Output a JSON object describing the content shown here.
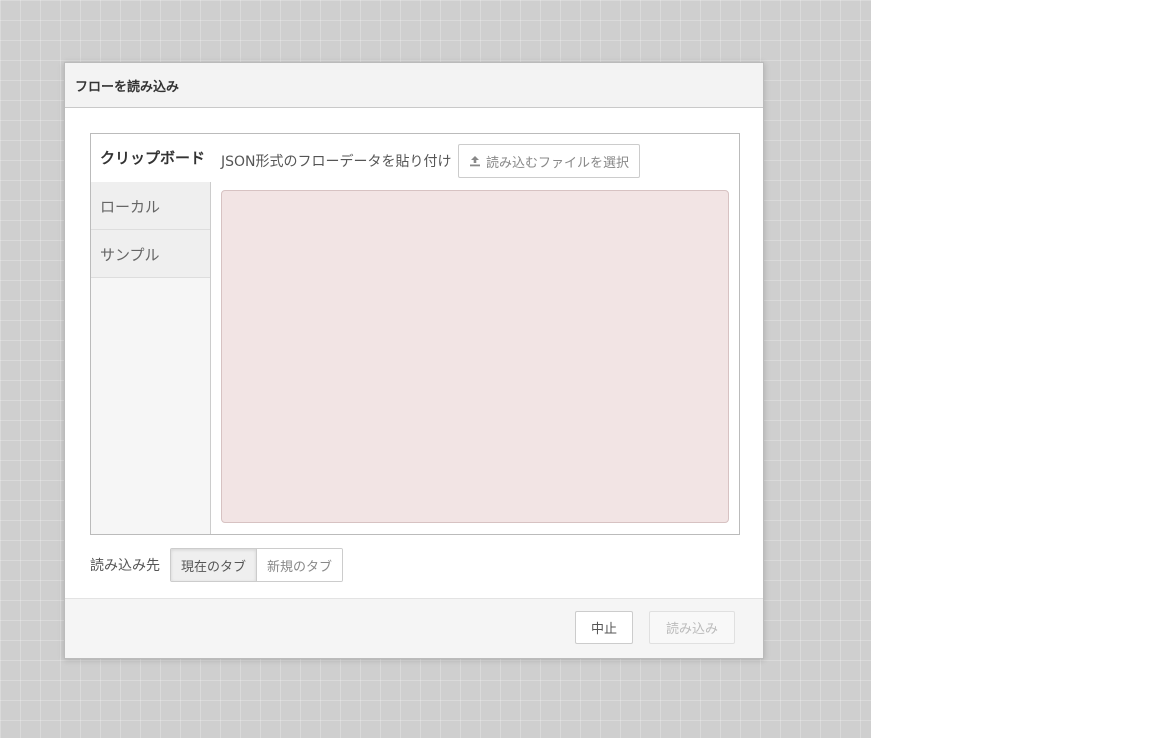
{
  "dialog": {
    "title": "フローを読み込み",
    "tabs": [
      {
        "label": "クリップボード",
        "active": true
      },
      {
        "label": "ローカル",
        "active": false
      },
      {
        "label": "サンプル",
        "active": false
      }
    ],
    "clipboard": {
      "paste_label": "JSON形式のフローデータを貼り付け",
      "select_file_label": "読み込むファイルを選択",
      "select_file_icon": "upload-icon",
      "textarea_value": ""
    },
    "target": {
      "label": "読み込み先",
      "options": [
        {
          "label": "現在のタブ",
          "selected": true
        },
        {
          "label": "新規のタブ",
          "selected": false
        }
      ]
    },
    "footer": {
      "cancel_label": "中止",
      "import_label": "読み込み",
      "import_enabled": false
    }
  },
  "colors": {
    "workspace_background": "#cfcfcf",
    "textarea_background": "#f2e4e4"
  }
}
